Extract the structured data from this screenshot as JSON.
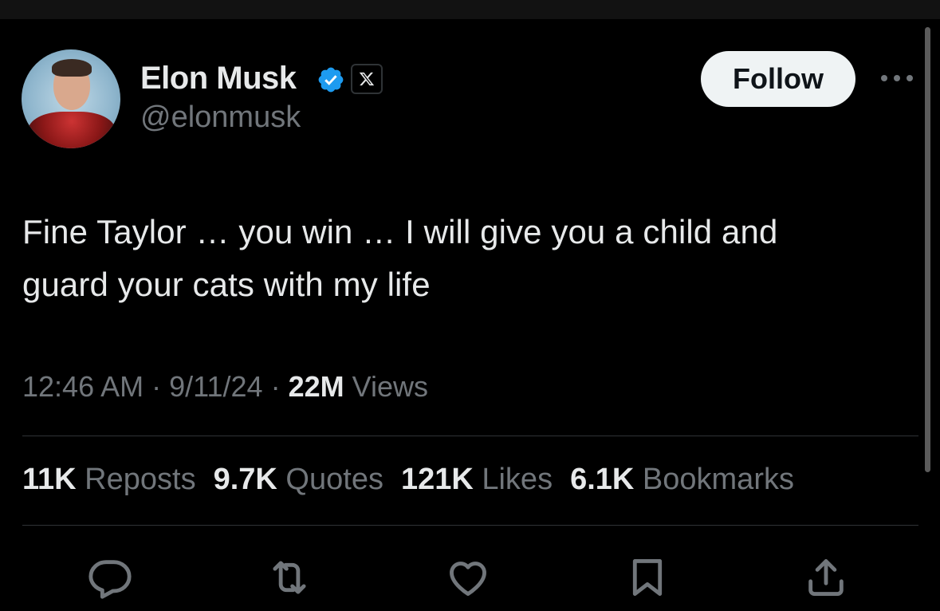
{
  "author": {
    "name": "Elon Musk",
    "handle": "@elonmusk",
    "avatar_icon": "avatar-photo",
    "verified_color": "#1d9bf0"
  },
  "follow_label": "Follow",
  "tweet": {
    "line1": "Fine Taylor … you win … I will give you a child and",
    "line2": "guard your cats with my life"
  },
  "meta": {
    "time": "12:46 AM",
    "sep1": " · ",
    "date": "9/11/24",
    "sep2": " · ",
    "views_count": "22M",
    "views_label": " Views"
  },
  "stats": {
    "reposts": {
      "count": "11K",
      "label": " Reposts"
    },
    "quotes": {
      "count": "9.7K",
      "label": " Quotes"
    },
    "likes": {
      "count": "121K",
      "label": " Likes"
    },
    "bookmarks": {
      "count": "6.1K",
      "label": " Bookmarks"
    }
  },
  "actions": [
    "reply-icon",
    "repost-icon",
    "like-icon",
    "bookmark-icon",
    "share-icon"
  ],
  "colors": {
    "background": "#000000",
    "text": "#e7e9ea",
    "secondary": "#71767b",
    "divider": "#2f3336"
  }
}
